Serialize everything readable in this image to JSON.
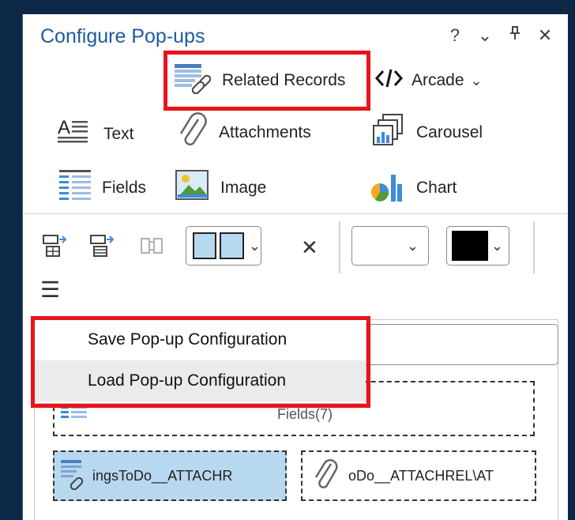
{
  "pane": {
    "title": "Configure Pop-ups",
    "controls": [
      "?",
      "⌄",
      "Ҵ",
      "✕"
    ]
  },
  "toolbar": {
    "related_records": "Related Records",
    "arcade": "Arcade",
    "arcade_chevron": "⌄",
    "text": "Text",
    "attachments": "Attachments",
    "carousel": "Carousel",
    "fields": "Fields",
    "image": "Image",
    "chart": "Chart"
  },
  "format_bar": {
    "remove_glyph": "✕",
    "dropdown_chevron": "⌄",
    "menu_glyph": "☰"
  },
  "menu": {
    "items": [
      {
        "label": "Save Pop-up Configuration"
      },
      {
        "label": "Load Pop-up Configuration"
      }
    ]
  },
  "elements": {
    "fields_label": "Fields(7)",
    "related_label": "ingsToDo__ATTACHR",
    "attach_label": "oDo__ATTACHREL\\AT"
  },
  "colors": {
    "background": "#0d2847",
    "title": "#1e5aa0",
    "highlight": "#e8141b",
    "selected": "#b8d8f0",
    "icon_blue": "#3d8bd9"
  },
  "icons": {
    "related_records": "related-records-icon",
    "arcade": "code-icon",
    "text": "text-icon",
    "attachments": "paperclip-icon",
    "carousel": "carousel-icon",
    "fields": "fields-icon",
    "image": "image-icon",
    "chart": "chart-icon"
  }
}
